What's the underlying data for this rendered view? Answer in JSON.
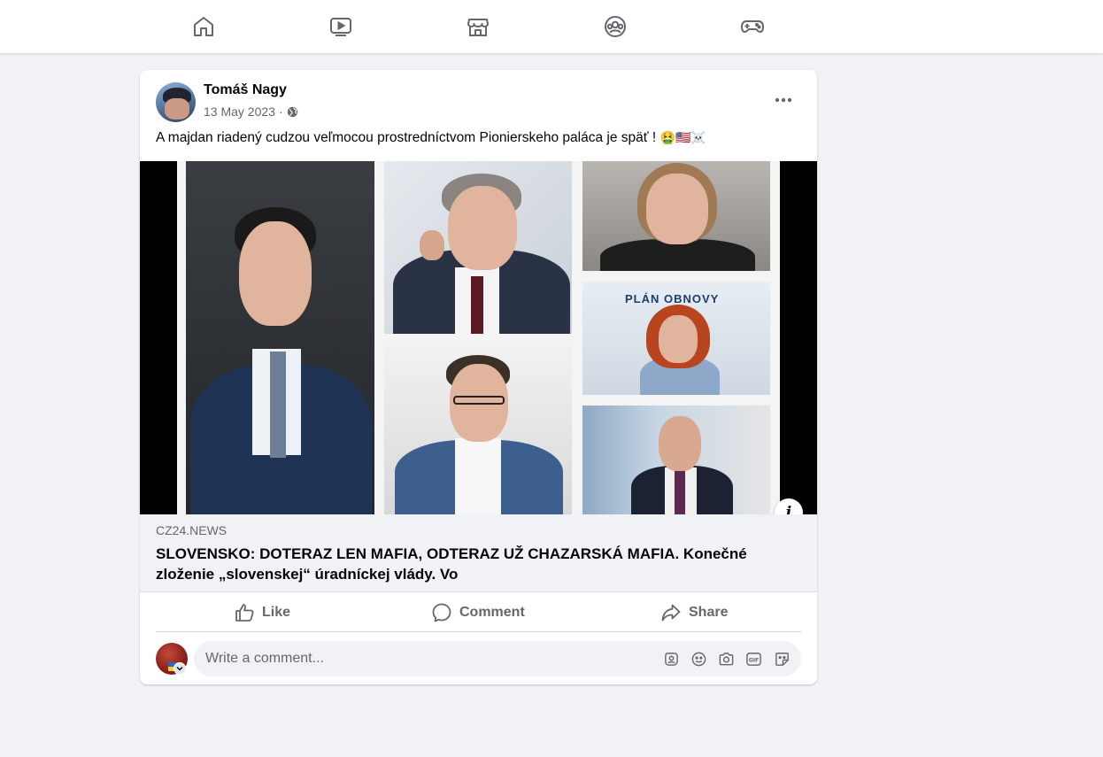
{
  "nav": {
    "items": [
      {
        "name": "home-icon"
      },
      {
        "name": "video-icon"
      },
      {
        "name": "marketplace-icon"
      },
      {
        "name": "groups-icon"
      },
      {
        "name": "gaming-icon"
      }
    ]
  },
  "post": {
    "author": "Tomáš Nagy",
    "date": "13 May 2023",
    "separator": "·",
    "privacy_icon": "globe-icon",
    "text": "A majdan riadený cudzou veľmocou prostredníctvom Pionierskeho paláca je späť !",
    "emojis": [
      "🤮",
      "🇺🇸",
      "☠️"
    ],
    "image_sign_text": "PLÁN OBNOVY"
  },
  "link": {
    "domain": "CZ24.NEWS",
    "title": "SLOVENSKO: DOTERAZ LEN MAFIA, ODTERAZ UŽ CHAZARSKÁ MAFIA. Konečné zloženie „slovenskej“ úradníckej vlády. Vo",
    "info_label": "i"
  },
  "actions": {
    "like": "Like",
    "comment": "Comment",
    "share": "Share"
  },
  "comment": {
    "placeholder": "Write a comment..."
  },
  "colors": {
    "background": "#f0f2f5",
    "text_secondary": "#65676b"
  }
}
